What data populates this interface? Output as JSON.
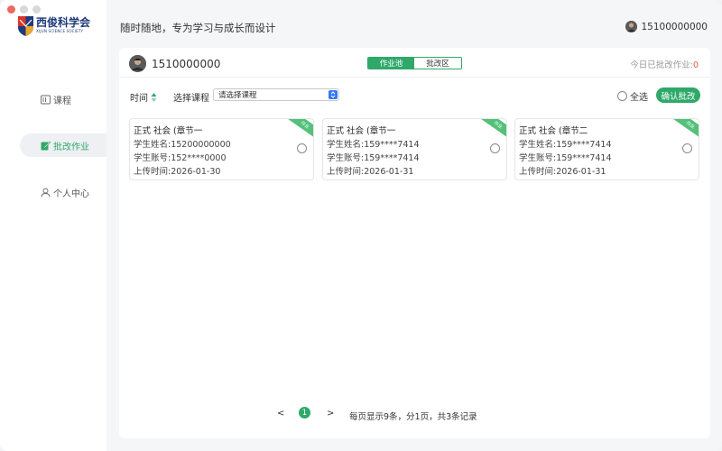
{
  "brand": {
    "name_cn": "西俊科学会",
    "name_en": "XIJUN SCIENCE SOCIETY",
    "accent": "#2fa86a"
  },
  "sidebar": {
    "items": [
      {
        "label": "课程",
        "icon": "book-icon",
        "active": false
      },
      {
        "label": "批改作业",
        "icon": "edit-icon",
        "active": true
      },
      {
        "label": "个人中心",
        "icon": "person-icon",
        "active": false
      }
    ]
  },
  "header": {
    "slogan": "随时随地，专为学习与成长而设计",
    "user": "15100000000"
  },
  "panel": {
    "user": "1510000000",
    "tabs": [
      {
        "label": "作业池",
        "active": true
      },
      {
        "label": "批改区",
        "active": false
      }
    ],
    "today_label": "今日已批改作业:",
    "today_count": "0"
  },
  "filter": {
    "time_label": "时间",
    "course_label": "选择课程",
    "course_placeholder": "请选择课程",
    "select_all": "全选",
    "confirm": "确认批改"
  },
  "cards": [
    {
      "title": "正式 社会 (章节一",
      "name": "学生姓名:15200000000",
      "account": "学生账号:152****0000",
      "time": "上传时间:2026-01-30",
      "ribbon": "作业"
    },
    {
      "title": "正式 社会 (章节一",
      "name": "学生姓名:159****7414",
      "account": "学生账号:159****7414",
      "time": "上传时间:2026-01-31",
      "ribbon": "作业"
    },
    {
      "title": "正式 社会 (章节二",
      "name": "学生姓名:159****7414",
      "account": "学生账号:159****7414",
      "time": "上传时间:2026-01-31",
      "ribbon": "作业"
    }
  ],
  "pagination": {
    "prev": "<",
    "page": "1",
    "next": ">",
    "info": "每页显示9条，分1页，共3条记录"
  }
}
